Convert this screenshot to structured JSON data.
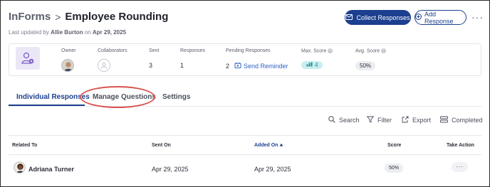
{
  "header": {
    "breadcrumb_root": "InForms",
    "breadcrumb_sep": ">",
    "page_title": "Employee Rounding",
    "updated_prefix": "Last updated by",
    "updated_by": "Allie Burton",
    "updated_on_prefix": "on",
    "updated_date": "Apr 29, 2025",
    "collect_label": "Collect Responses",
    "add_label": "Add Response",
    "more_label": "···"
  },
  "summary": {
    "owner_label": "Owner",
    "collaborators_label": "Collaborators",
    "sent_label": "Sent",
    "sent_value": "3",
    "responses_label": "Responses",
    "responses_value": "1",
    "pending_label": "Pending Responses",
    "pending_value": "2",
    "reminder_label": "Send Reminder",
    "max_score_label": "Max. Score",
    "max_score_value": "4",
    "avg_score_label": "Avg. Score",
    "avg_score_value": "50%",
    "info_glyph": "i"
  },
  "tabs": [
    {
      "label": "Individual Responses",
      "active": true
    },
    {
      "label": "Manage Questions",
      "active": false
    },
    {
      "label": "Settings",
      "active": false
    }
  ],
  "toolbar": {
    "search_label": "Search",
    "filter_label": "Filter",
    "export_label": "Export",
    "completed_label": "Completed"
  },
  "table": {
    "columns": [
      "Related To",
      "Sent On",
      "Added On",
      "Score",
      "Take Action"
    ],
    "sorted_column": "Added On",
    "rows": [
      {
        "related_to": "Adriana Turner",
        "sent_on": "Apr 29, 2025",
        "added_on": "Apr 29, 2025",
        "score": "50%",
        "action": "···"
      }
    ]
  },
  "colors": {
    "primary": "#1c3f8f",
    "link": "#2f63c7",
    "teal_pill": "#c8eef0",
    "annotation": "#d9534f"
  },
  "icons": [
    "user-form-icon",
    "mail-icon",
    "plus-circle-icon",
    "bell-icon",
    "chart-icon",
    "search-icon",
    "filter-icon",
    "export-icon",
    "completed-icon",
    "sort-asc-icon"
  ]
}
